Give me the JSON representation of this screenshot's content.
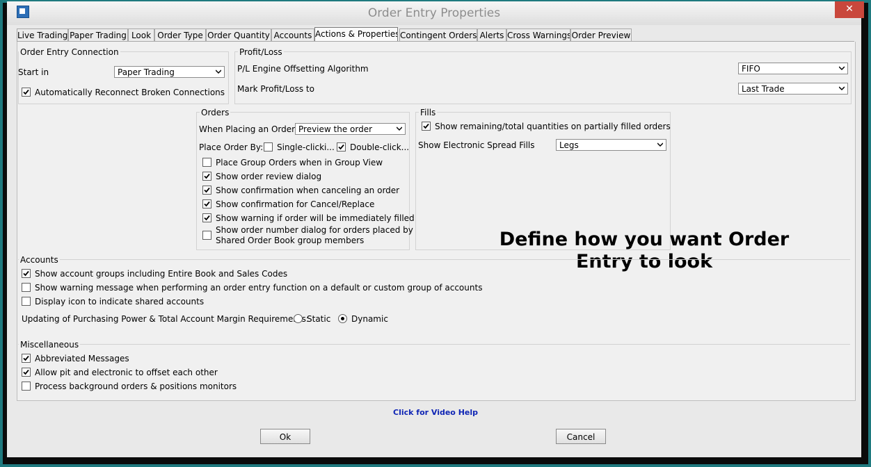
{
  "window": {
    "title": "Order Entry Properties"
  },
  "tabs": [
    "Live Trading",
    "Paper Trading",
    "Look",
    "Order Type",
    "Order Quantity",
    "Accounts",
    "Actions & Properties",
    "Contingent Orders",
    "Alerts",
    "Cross Warnings",
    "Order Preview"
  ],
  "active_tab": "Actions & Properties",
  "connection": {
    "legend": "Order Entry Connection",
    "start_in_label": "Start in",
    "start_in_value": "Paper Trading",
    "reconnect_label": "Automatically Reconnect Broken Connections",
    "reconnect_checked": true
  },
  "profit_loss": {
    "legend": "Profit/Loss",
    "engine_label": "P/L Engine Offsetting Algorithm",
    "engine_value": "FIFO",
    "mark_label": "Mark Profit/Loss to",
    "mark_value": "Last Trade"
  },
  "orders": {
    "legend": "Orders",
    "when_placing_label": "When Placing an Order",
    "when_placing_value": "Preview the order",
    "place_by_label": "Place Order By:",
    "single_click_label": "Single-clicki...",
    "single_click_checked": false,
    "double_click_label": "Double-click...",
    "double_click_checked": true,
    "options": [
      {
        "label": "Place Group Orders when in Group View",
        "checked": false
      },
      {
        "label": "Show order review dialog",
        "checked": true
      },
      {
        "label": "Show confirmation when canceling an order",
        "checked": true
      },
      {
        "label": "Show confirmation for Cancel/Replace",
        "checked": true
      },
      {
        "label": "Show warning if order will be immediately filled",
        "checked": true
      }
    ],
    "shared_line1": "Show order number dialog for orders placed by",
    "shared_line2": "Shared Order Book group members",
    "shared_checked": false
  },
  "fills": {
    "legend": "Fills",
    "remaining_label": "Show remaining/total quantities on partially filled orders",
    "remaining_checked": true,
    "spread_label": "Show Electronic Spread Fills",
    "spread_value": "Legs"
  },
  "accounts": {
    "legend": "Accounts",
    "options": [
      {
        "label": "Show account groups including Entire Book and Sales Codes",
        "checked": true
      },
      {
        "label": "Show warning message when performing an order entry function on a default or custom group of accounts",
        "checked": false
      },
      {
        "label": "Display icon to indicate shared accounts",
        "checked": false
      }
    ],
    "updating_label": "Updating of Purchasing Power & Total Account Margin Requirements:",
    "static_label": "Static",
    "dynamic_label": "Dynamic",
    "selected_mode": "Dynamic"
  },
  "misc": {
    "legend": "Miscellaneous",
    "options": [
      {
        "label": "Abbreviated Messages",
        "checked": true
      },
      {
        "label": "Allow pit and electronic to offset each other",
        "checked": true
      },
      {
        "label": "Process background orders & positions monitors",
        "checked": false
      }
    ]
  },
  "help_link": "Click for Video Help",
  "ok_label": "Ok",
  "cancel_label": "Cancel",
  "overlay_text": {
    "line1": "Define how you want Order",
    "line2": "Entry to look"
  }
}
